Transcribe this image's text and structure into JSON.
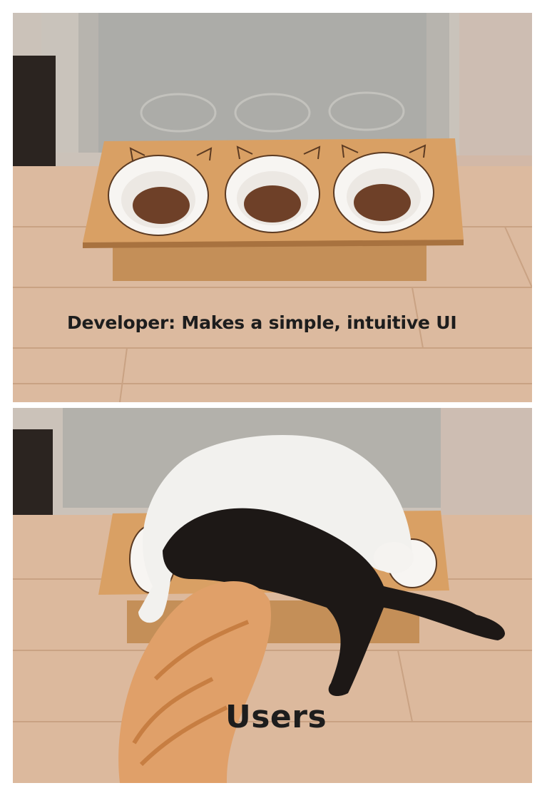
{
  "meme": {
    "top_caption": "Developer:  Makes a simple, intuitive UI",
    "bottom_caption": "Users"
  }
}
